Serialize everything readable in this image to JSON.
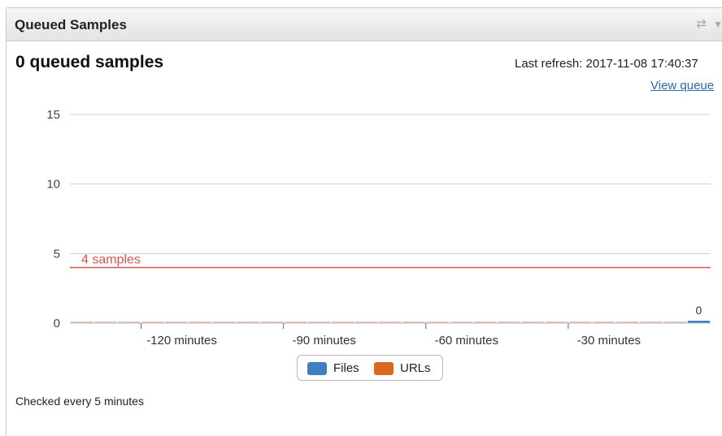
{
  "panel": {
    "title": "Queued Samples",
    "icons": {
      "refresh": "refresh-icon",
      "menu": "chevron-down-icon"
    }
  },
  "summary": {
    "headline": "0 queued samples",
    "last_refresh": "Last refresh: 2017-11-08 17:40:37",
    "view_queue_label": "View queue"
  },
  "chart_data": {
    "type": "bar",
    "stacked": true,
    "ylim": [
      0,
      15
    ],
    "yticks": [
      "0",
      "5",
      "10",
      "15"
    ],
    "xlim": [
      -135,
      0
    ],
    "xticks": [
      {
        "value": -120,
        "label": "-120 minutes"
      },
      {
        "value": -90,
        "label": "-90 minutes"
      },
      {
        "value": -60,
        "label": "-60 minutes"
      },
      {
        "value": -30,
        "label": "-30 minutes"
      }
    ],
    "x": [
      -135,
      -130,
      -125,
      -120,
      -115,
      -110,
      -105,
      -100,
      -95,
      -90,
      -85,
      -80,
      -75,
      -70,
      -65,
      -60,
      -55,
      -50,
      -45,
      -40,
      -35,
      -30,
      -25,
      -20,
      -15,
      -10,
      -5
    ],
    "series": [
      {
        "name": "Files",
        "color": "#3f7fc0",
        "values": [
          0,
          0,
          0,
          0,
          0,
          0,
          0,
          0,
          0,
          0,
          0,
          0,
          0,
          0,
          0,
          0,
          0,
          0,
          0,
          0,
          0,
          0,
          0,
          0,
          0,
          0,
          0
        ]
      },
      {
        "name": "URLs",
        "color": "#d9691e",
        "values": [
          0,
          0,
          0,
          0,
          0,
          0,
          0,
          0,
          0,
          0,
          0,
          0,
          0,
          0,
          0,
          0,
          0,
          0,
          0,
          0,
          0,
          0,
          0,
          0,
          0,
          0,
          0
        ]
      }
    ],
    "last_bar_label": "0",
    "threshold": {
      "value": 4,
      "label": "4 samples",
      "color": "#d9534f"
    },
    "grid": true,
    "legend_placement": "bottom"
  },
  "footer": {
    "note": "Checked every 5 minutes"
  }
}
